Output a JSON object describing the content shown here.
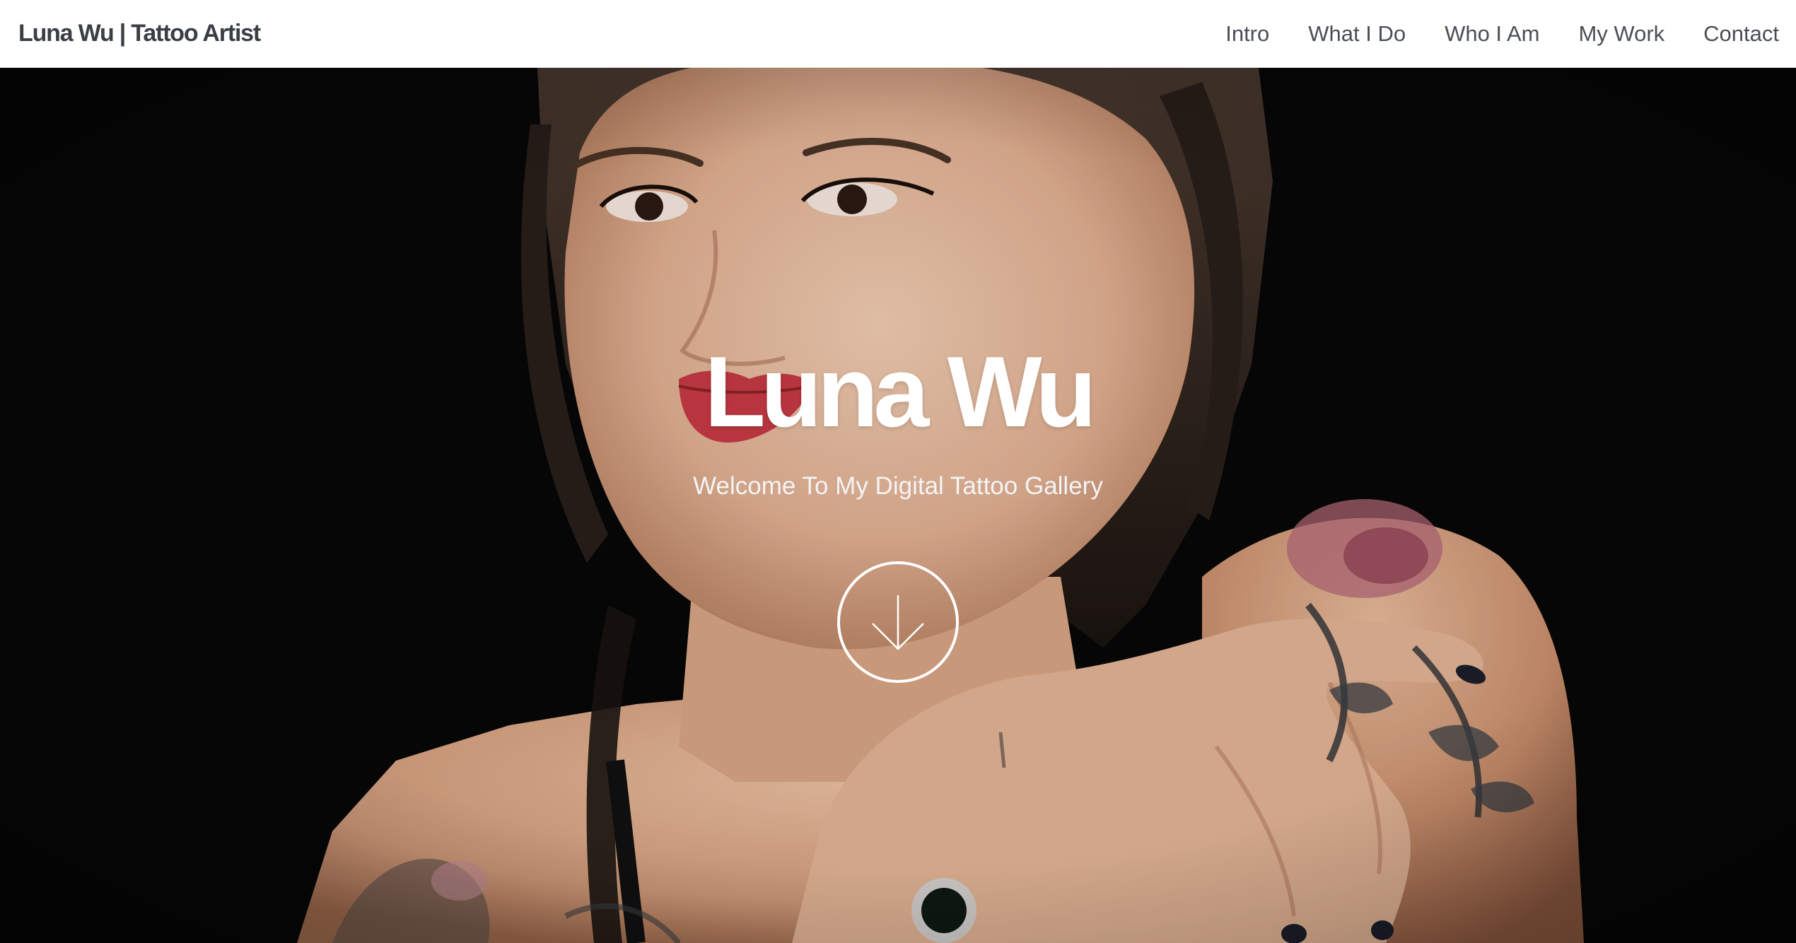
{
  "header": {
    "brand": "Luna Wu | Tattoo Artist",
    "nav": [
      {
        "label": "Intro"
      },
      {
        "label": "What I Do"
      },
      {
        "label": "Who I Am"
      },
      {
        "label": "My Work"
      },
      {
        "label": "Contact"
      }
    ]
  },
  "hero": {
    "title": "Luna Wu",
    "subtitle": "Welcome To My Digital Tattoo Gallery",
    "scroll_icon": "arrow-down-icon",
    "photo_description": "portrait-photo"
  },
  "colors": {
    "nav_text": "#4a4f55",
    "brand_text": "#3a3f45",
    "hero_text": "#ffffff",
    "hero_bg": "#060606"
  }
}
